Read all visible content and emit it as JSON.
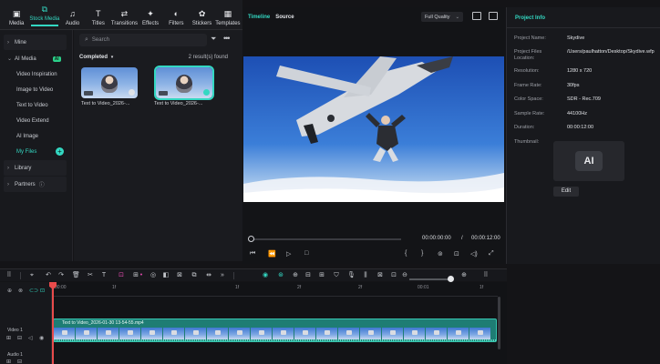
{
  "toolbar": {
    "items": [
      {
        "label": "Media",
        "icon": "media-icon"
      },
      {
        "label": "Stock Media",
        "icon": "stock-media-icon"
      },
      {
        "label": "Audio",
        "icon": "audio-icon"
      },
      {
        "label": "Titles",
        "icon": "titles-icon"
      },
      {
        "label": "Transitions",
        "icon": "transitions-icon"
      },
      {
        "label": "Effects",
        "icon": "effects-icon"
      },
      {
        "label": "Filters",
        "icon": "filters-icon"
      },
      {
        "label": "Stickers",
        "icon": "stickers-icon"
      },
      {
        "label": "Templates",
        "icon": "templates-icon"
      }
    ],
    "active_index": 1
  },
  "sidebar": {
    "mine": "Mine",
    "ai_media": "AI Media",
    "ai_badge": "AI",
    "sub_items": [
      "Video Inspiration",
      "Image to Video",
      "Text to Video",
      "Video Extend",
      "AI Image",
      "My Files"
    ],
    "active_sub": "My Files",
    "library": "Library",
    "partners": "Partners"
  },
  "media": {
    "search_placeholder": "Search",
    "completed_label": "Completed",
    "results": "2 result(s) found",
    "items": [
      {
        "label": "Text to Video_2026-..."
      },
      {
        "label": "Text to Video_2026-..."
      }
    ]
  },
  "player": {
    "tab_timeline": "Timeline",
    "tab_source": "Source",
    "quality": "Full Quality",
    "time_current": "00:00:00:00",
    "time_sep": "/",
    "time_total": "00:00:12:00",
    "progress": 0.0
  },
  "project": {
    "title": "Project Info",
    "fields": [
      {
        "key": "Project Name:",
        "value": "Skydive"
      },
      {
        "key": "Project Files Location:",
        "value": "/Users/paulhatton/Desktop/Skydive.wfp"
      },
      {
        "key": "Resolution:",
        "value": "1280 x 720"
      },
      {
        "key": "Frame Rate:",
        "value": "30fps"
      },
      {
        "key": "Color Space:",
        "value": "SDR - Rec.709"
      },
      {
        "key": "Sample Rate:",
        "value": "44100Hz"
      },
      {
        "key": "Duration:",
        "value": "00:00:12:00"
      },
      {
        "key": "Thumbnail:",
        "value": ""
      }
    ],
    "thumb_text": "AI",
    "edit_label": "Edit"
  },
  "timeline": {
    "ruler": [
      "00:00",
      "1f",
      "1f",
      "2f",
      "2f",
      "00:01",
      "1f"
    ],
    "clip_title": "Text to Video_2026-01-30 13-54-55.mp4",
    "track_video": "Video 1",
    "track_audio": "Audio 1",
    "zoom_level": 0.9
  },
  "colors": {
    "accent": "#33d8c2",
    "playhead": "#e84b4b",
    "clip": "#1e7d74",
    "bg": "#141417"
  }
}
